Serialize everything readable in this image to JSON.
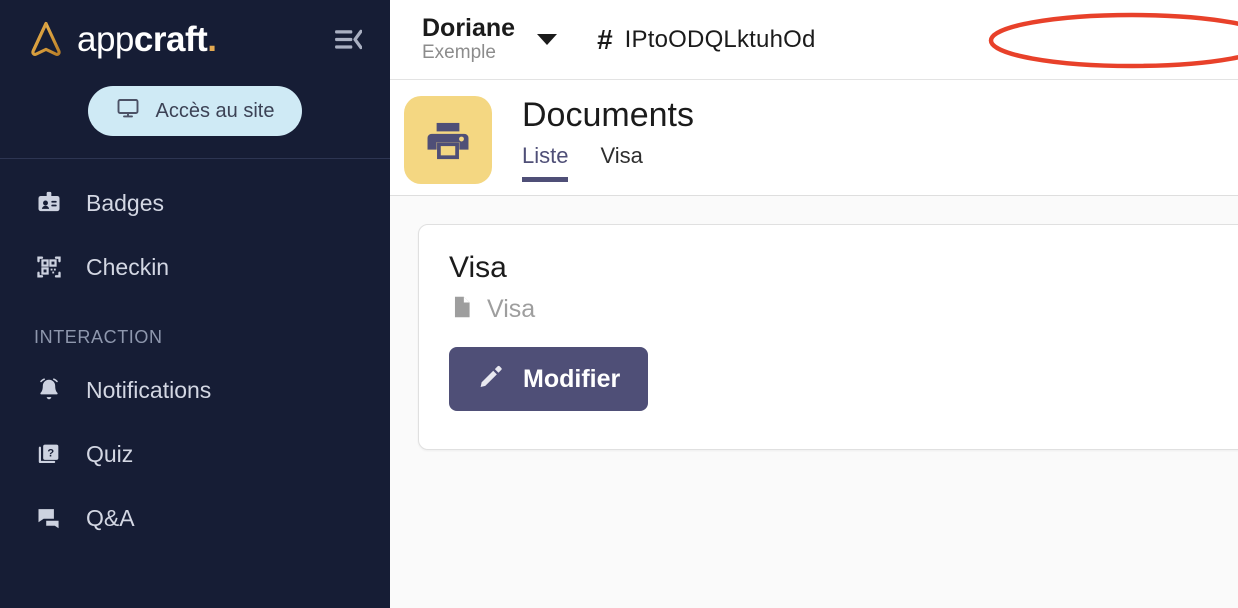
{
  "sidebar": {
    "logo": {
      "text_light": "app",
      "text_bold": "craft",
      "dot": ".",
      "mark": "appcraft-logo-icon"
    },
    "collapse_icon": "collapse-menu-icon",
    "site_button": {
      "label": "Accès au site",
      "icon": "monitor-icon"
    },
    "items": [
      {
        "label": "Badges",
        "icon": "id-badge-icon"
      },
      {
        "label": "Checkin",
        "icon": "qr-code-icon"
      }
    ],
    "section_label": "INTERACTION",
    "interaction_items": [
      {
        "label": "Notifications",
        "icon": "bell-icon"
      },
      {
        "label": "Quiz",
        "icon": "quiz-question-icon"
      },
      {
        "label": "Q&A",
        "icon": "chat-bubbles-icon"
      }
    ]
  },
  "topbar": {
    "org_name": "Doriane",
    "org_sub": "Exemple",
    "dropdown_icon": "chevron-down-icon",
    "hash_symbol": "#",
    "event_code": "IPtoODQLktuhOd",
    "annotation_color": "#e8412a"
  },
  "page": {
    "icon": "printer-icon",
    "icon_bg": "#f4d782",
    "title": "Documents",
    "tabs": [
      {
        "label": "Liste",
        "active": true
      },
      {
        "label": "Visa",
        "active": false
      }
    ]
  },
  "card": {
    "title": "Visa",
    "file_icon": "document-file-icon",
    "file_name": "Visa",
    "edit_button": {
      "label": "Modifier",
      "icon": "pencil-icon",
      "color": "#4f4f77"
    }
  }
}
